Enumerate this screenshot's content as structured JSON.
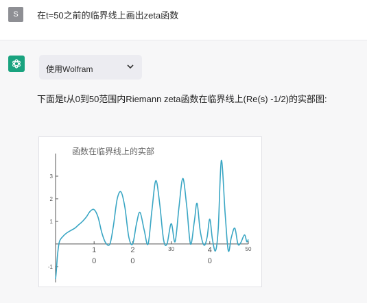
{
  "user": {
    "avatar_letter": "S",
    "message": "在t=50之前的临界线上画出zeta函数"
  },
  "assistant": {
    "plugin_label": "使用Wolfram",
    "answer_text": "下面是t从0到50范围内Riemann zeta函数在临界线上(Re(s) -1/2)的实部图:"
  },
  "colors": {
    "accent": "#19a37f",
    "curve": "#3aa6c4"
  },
  "chart_data": {
    "type": "line",
    "title": "函数在临界线上的实部",
    "xlabel": "",
    "ylabel": "",
    "xlim": [
      0,
      50
    ],
    "ylim": [
      -1.7,
      4.0
    ],
    "x_tick_labels": [
      {
        "lines": [
          "1",
          "0"
        ],
        "x": 10
      },
      {
        "lines": [
          "2",
          "0"
        ],
        "x": 20
      },
      {
        "lines": [
          "30"
        ],
        "x": 30
      },
      {
        "lines": [
          "4",
          "0"
        ],
        "x": 40
      },
      {
        "lines": [
          "50"
        ],
        "x": 50
      }
    ],
    "y_ticks": [
      -1,
      1,
      2,
      3
    ],
    "y_tick_labels": [
      "-1",
      "1",
      "2",
      "3"
    ],
    "series": [
      {
        "x": [
          0,
          0.2,
          0.5,
          1,
          2,
          3,
          4,
          5,
          6,
          7,
          8,
          9,
          10,
          11,
          12,
          13,
          14.1,
          15,
          16,
          17,
          18,
          19,
          20,
          21,
          21.9,
          23,
          24,
          25,
          26,
          27,
          28,
          28.9,
          30,
          31,
          32,
          33,
          34,
          35,
          36,
          36.7,
          37.5,
          38.5,
          39.3,
          40,
          40.7,
          41.5,
          42.2,
          43,
          44,
          44.8,
          45.6,
          46.5,
          47.3,
          48,
          49,
          49.6,
          50
        ],
        "y": [
          -1.55,
          -1.2,
          -0.5,
          0.1,
          0.35,
          0.5,
          0.6,
          0.7,
          0.85,
          1.0,
          1.2,
          1.45,
          1.52,
          1.2,
          0.5,
          0.05,
          0.0,
          0.8,
          2.0,
          2.3,
          1.6,
          0.3,
          0.0,
          0.9,
          1.4,
          0.6,
          0.0,
          1.5,
          2.8,
          1.8,
          0.2,
          0.0,
          0.9,
          0.1,
          1.6,
          2.9,
          1.7,
          0.0,
          1.0,
          1.8,
          0.6,
          -0.05,
          0.3,
          1.1,
          0.2,
          -0.3,
          0.7,
          3.7,
          1.3,
          -0.3,
          0.3,
          0.7,
          0.0,
          0.05,
          0.4,
          0.1,
          0.2
        ]
      }
    ]
  }
}
